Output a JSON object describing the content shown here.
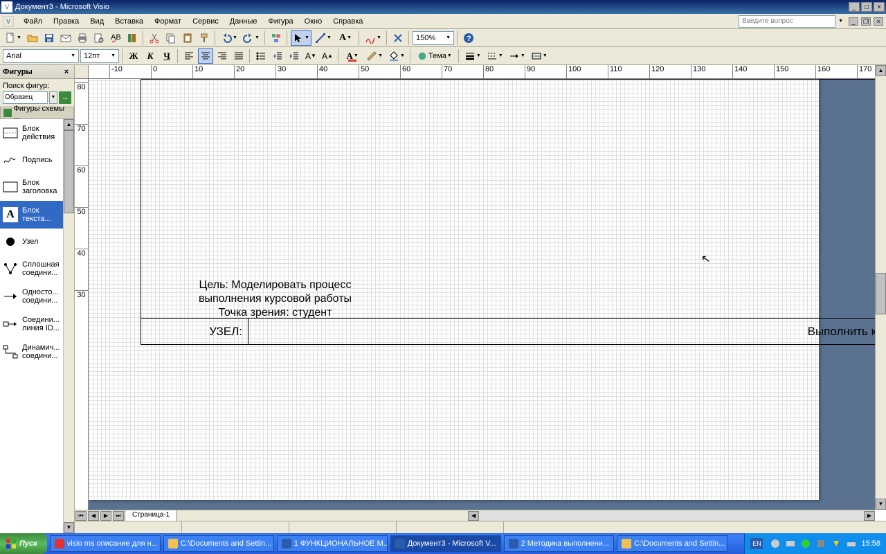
{
  "title": "Документ3 - Microsoft Visio",
  "menus": [
    "Файл",
    "Правка",
    "Вид",
    "Вставка",
    "Формат",
    "Сервис",
    "Данные",
    "Фигура",
    "Окно",
    "Справка"
  ],
  "askQuestion": "Введите вопрос",
  "zoom": "150%",
  "font": {
    "name": "Arial",
    "size": "12пт"
  },
  "shapesPane": {
    "title": "Фигуры",
    "searchLabel": "Поиск фигур:",
    "searchText": "Образец",
    "stencil": "Фигуры схемы ...",
    "shapes": [
      {
        "label": "Блок\nдействия",
        "type": "rect-dash"
      },
      {
        "label": "Подпись",
        "type": "sig"
      },
      {
        "label": "Блок\nзаголовка",
        "type": "rect"
      },
      {
        "label": "Блок\nтекста...",
        "type": "textA",
        "sel": true
      },
      {
        "label": "Узел",
        "type": "dot"
      },
      {
        "label": "Сплошная\nсоедини...",
        "type": "spline"
      },
      {
        "label": "Односто...\nсоедини...",
        "type": "arrow"
      },
      {
        "label": "Соедини...\nлиния ID...",
        "type": "idline"
      },
      {
        "label": "Динамич...\nсоедини...",
        "type": "dyn"
      }
    ]
  },
  "rulerH": [
    "-10",
    "0",
    "10",
    "20",
    "30",
    "40",
    "50",
    "60",
    "70",
    "80",
    "90",
    "100",
    "110",
    "120",
    "130",
    "140",
    "150",
    "160",
    "170"
  ],
  "rulerV": [
    "80",
    "70",
    "60",
    "50",
    "40",
    "30"
  ],
  "canvas": {
    "textBlock": "Цель: Моделировать процесс\nвыполнения курсовой работы\nТочка зрения: студент",
    "node": "УЗЕЛ:",
    "footerTitle": "Выполнить курсовую работу"
  },
  "pageTab": "Страница-1",
  "taskbar": {
    "start": "Пуск",
    "tasks": [
      {
        "label": "visio ms описание для н...",
        "icon": "#d33"
      },
      {
        "label": "C:\\Documents and Settin...",
        "icon": "#f0c050"
      },
      {
        "label": "1 ФУНКЦИОНАЛЬНОЕ М...",
        "icon": "#2a5caa"
      },
      {
        "label": "Документ3 - Microsoft V...",
        "icon": "#2a5caa",
        "active": true
      },
      {
        "label": "2 Методика выполнени...",
        "icon": "#2a5caa"
      },
      {
        "label": "C:\\Documents and Settin...",
        "icon": "#f0c050"
      }
    ],
    "lang": "EN",
    "clock": "15:58"
  },
  "themeLabel": "Тема"
}
